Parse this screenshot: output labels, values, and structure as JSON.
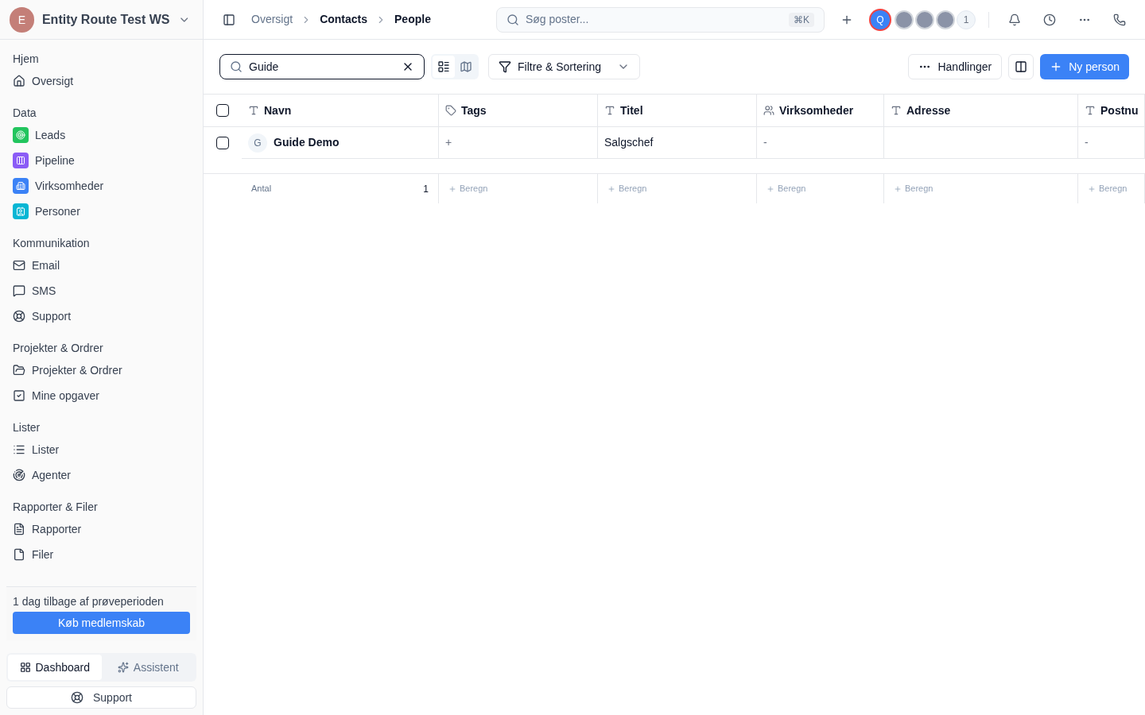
{
  "workspace": {
    "initial": "E",
    "name": "Entity Route Test WS"
  },
  "breadcrumb": [
    {
      "label": "Oversigt",
      "muted": true
    },
    {
      "label": "Contacts",
      "muted": false
    },
    {
      "label": "People",
      "muted": false
    }
  ],
  "global_search": {
    "placeholder": "Søg poster...",
    "shortcut": "⌘K"
  },
  "avatars": [
    {
      "label": "Q",
      "kind": "me"
    },
    {
      "kind": "other"
    },
    {
      "kind": "other"
    },
    {
      "kind": "other"
    },
    {
      "label": "1",
      "kind": "more"
    }
  ],
  "sidebar": {
    "sections": [
      {
        "title": "Hjem",
        "items": [
          {
            "label": "Oversigt"
          }
        ]
      },
      {
        "title": "Data",
        "items": [
          {
            "label": "Leads",
            "color": "#22c55e"
          },
          {
            "label": "Pipeline",
            "color": "#8b5cf6"
          },
          {
            "label": "Virksomheder",
            "color": "#3b82f6"
          },
          {
            "label": "Personer",
            "color": "#06b6d4"
          }
        ]
      },
      {
        "title": "Kommunikation",
        "items": [
          {
            "label": "Email"
          },
          {
            "label": "SMS"
          },
          {
            "label": "Support"
          }
        ]
      },
      {
        "title": "Projekter & Ordrer",
        "items": [
          {
            "label": "Projekter & Ordrer"
          },
          {
            "label": "Mine opgaver"
          }
        ]
      },
      {
        "title": "Lister",
        "items": [
          {
            "label": "Lister"
          },
          {
            "label": "Agenter"
          }
        ]
      },
      {
        "title": "Rapporter & Filer",
        "items": [
          {
            "label": "Rapporter"
          },
          {
            "label": "Filer"
          }
        ]
      }
    ],
    "trial": {
      "text": "1 dag tilbage af prøveperioden",
      "button": "Køb medlemskab"
    },
    "tabs": [
      {
        "label": "Dashboard",
        "selected": true
      },
      {
        "label": "Assistent",
        "selected": false
      }
    ],
    "support": "Support"
  },
  "toolbar": {
    "search_value": "Guide",
    "views": [
      {
        "kind": "list",
        "selected": true
      },
      {
        "kind": "map",
        "selected": false
      }
    ],
    "filter": "Filtre & Sortering",
    "actions": "Handlinger",
    "new": "Ny person"
  },
  "table": {
    "all_checked": false,
    "columns": [
      {
        "label": "Navn",
        "kind": "text"
      },
      {
        "label": "Tags",
        "kind": "tag"
      },
      {
        "label": "Titel",
        "kind": "text"
      },
      {
        "label": "Virksomheder",
        "kind": "relation"
      },
      {
        "label": "Adresse",
        "kind": "text"
      },
      {
        "label": "Postnu",
        "kind": "text"
      }
    ],
    "rows": [
      {
        "checked": false,
        "avatar": "G",
        "cells": [
          "Guide Demo",
          "+",
          "Salgschef",
          "-",
          null,
          "-"
        ]
      }
    ],
    "footer": {
      "label": "Antal",
      "count": "1",
      "calcs": [
        "Beregn",
        "Beregn",
        "Beregn",
        "Beregn",
        "Beregn"
      ]
    }
  }
}
